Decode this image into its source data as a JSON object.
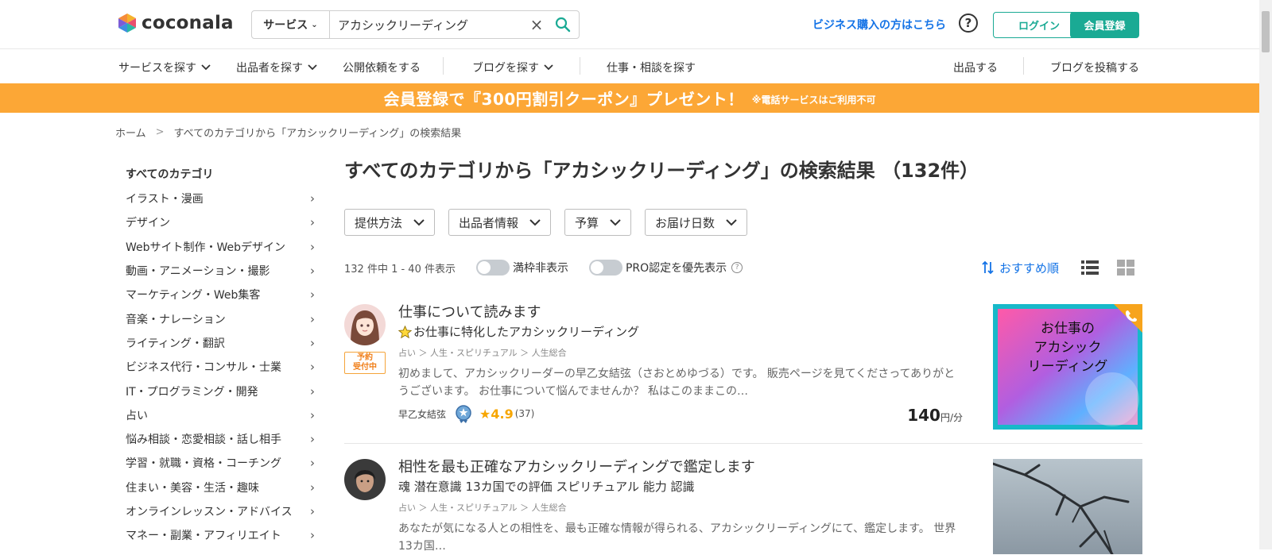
{
  "header": {
    "logo_text": "coconala",
    "search": {
      "scope": "サービス",
      "value": "アカシックリーディング",
      "placeholder": ""
    },
    "biz_link": "ビジネス購入の方はこちら",
    "help": "?",
    "login": "ログイン",
    "register": "会員登録"
  },
  "nav": {
    "items": [
      "サービスを探す",
      "出品者を探す",
      "公開依頼をする",
      "ブログを探す",
      "仕事・相談を探す"
    ],
    "right": [
      "出品する",
      "ブログを投稿する"
    ]
  },
  "banner": {
    "main": "会員登録で『300円割引クーポン』プレゼント！",
    "note": "※電話サービスはご利用不可"
  },
  "breadcrumb": [
    "ホーム",
    "すべてのカテゴリから「アカシックリーディング」の検索結果"
  ],
  "sidebar": {
    "title": "すべてのカテゴリ",
    "items": [
      "イラスト・漫画",
      "デザイン",
      "Webサイト制作・Webデザイン",
      "動画・アニメーション・撮影",
      "マーケティング・Web集客",
      "音楽・ナレーション",
      "ライティング・翻訳",
      "ビジネス代行・コンサル・士業",
      "IT・プログラミング・開発",
      "占い",
      "悩み相談・恋愛相談・話し相手",
      "学習・就職・資格・コーチング",
      "住まい・美容・生活・趣味",
      "オンラインレッスン・アドバイス",
      "マネー・副業・アフィリエイト"
    ]
  },
  "main": {
    "title_bold1": "すべてのカテゴリ",
    "title_mid": "から「",
    "title_bold2": "アカシックリーディング",
    "title_end": "」の検索結果 （132件）",
    "filters": [
      "提供方法",
      "出品者情報",
      "予算",
      "お届け日数"
    ],
    "count_text": "132 件中 1 - 40 件表示",
    "toggle1": "満枠非表示",
    "toggle2": "PRO認定を優先表示",
    "sort": "おすすめ順"
  },
  "cards": [
    {
      "title": "仕事について読みます",
      "subtitle": "お仕事に特化したアカシックリーディング",
      "category": "占い ＞ 人生・スピリチュアル ＞ 人生総合",
      "description": "初めまして、アカシックリーダーの早乙女結弦（さおとめゆづる）です。 販売ページを見てくださってありがとうございます。 お仕事について悩んでませんか？ 私はこのままこの…",
      "badge": "予約\n受付中",
      "seller": "早乙女結弦",
      "rating": "★4.9",
      "rating_count": "(37)",
      "price": "140",
      "price_unit": "円/分",
      "thumb_text": "お仕事の\nアカシック\nリーディング"
    },
    {
      "title": "相性を最も正確なアカシックリーディングで鑑定します",
      "subtitle": "魂 潜在意識 13カ国での評価 スピリチュアル 能力 認識",
      "category": "占い ＞ 人生・スピリチュアル ＞ 人生総合",
      "description": "あなたが気になる人との相性を、最も正確な情報が得られる、アカシックリーディングにて、鑑定します。 世界13カ国…"
    }
  ],
  "colors": {
    "accent": "#1aaa94",
    "link": "#1473e6",
    "banner": "#fca736",
    "star": "#f7a600"
  }
}
